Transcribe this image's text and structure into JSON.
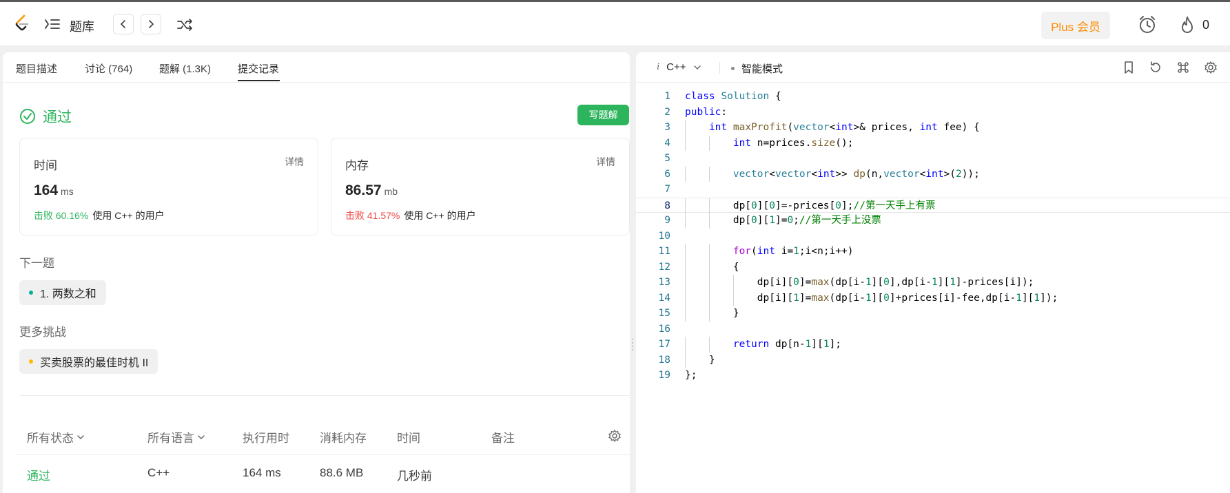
{
  "topbar": {
    "title": "题库",
    "plus_label": "Plus 会员",
    "fire_count": "0"
  },
  "tabs": [
    {
      "label": "题目描述"
    },
    {
      "label": "讨论 (764)"
    },
    {
      "label": "题解 (1.3K)"
    },
    {
      "label": "提交记录"
    }
  ],
  "result": {
    "status": "通过",
    "write_solution": "写题解",
    "time": {
      "label": "时间",
      "detail": "详情",
      "value": "164",
      "unit": "ms",
      "beat": "击败 60.16%",
      "beat_rest": "使用 C++ 的用户"
    },
    "memory": {
      "label": "内存",
      "detail": "详情",
      "value": "86.57",
      "unit": "mb",
      "beat": "击败 41.57%",
      "beat_rest": "使用 C++ 的用户"
    }
  },
  "next": {
    "title": "下一题",
    "item": "1. 两数之和",
    "more_title": "更多挑战",
    "more_item": "买卖股票的最佳时机 II"
  },
  "table": {
    "headers": [
      "所有状态",
      "所有语言",
      "执行用时",
      "消耗内存",
      "时间",
      "备注"
    ],
    "rows": [
      {
        "status": "通过",
        "language": "C++",
        "runtime": "164 ms",
        "memory": "88.6 MB",
        "time": "几秒前",
        "note": ""
      }
    ]
  },
  "editor": {
    "language": "C++",
    "mode": "智能模式",
    "line_numbers": [
      "1",
      "2",
      "3",
      "4",
      "5",
      "6",
      "7",
      "8",
      "9",
      "10",
      "11",
      "12",
      "13",
      "14",
      "15",
      "16",
      "17",
      "18",
      "19"
    ],
    "code_lines": [
      "class Solution {",
      "public:",
      "    int maxProfit(vector<int>& prices, int fee) {",
      "        int n=prices.size();",
      "",
      "        vector<vector<int>> dp(n,vector<int>(2));",
      "",
      "        dp[0][0]=-prices[0];//第一天手上有票",
      "        dp[0][1]=0;//第一天手上没票",
      "",
      "        for(int i=1;i<n;i++)",
      "        {",
      "            dp[i][0]=max(dp[i-1][0],dp[i-1][1]-prices[i]);",
      "            dp[i][1]=max(dp[i-1][0]+prices[i]-fee,dp[i-1][1]);",
      "        }",
      "",
      "        return dp[n-1][1];",
      "    }",
      "};"
    ]
  },
  "colors": {
    "accent_green": "#2db55d",
    "beat_red": "#ef4743",
    "plus_orange": "#ff8a00",
    "next_dot": "#00af9b",
    "more_dot": "#ffb800"
  }
}
